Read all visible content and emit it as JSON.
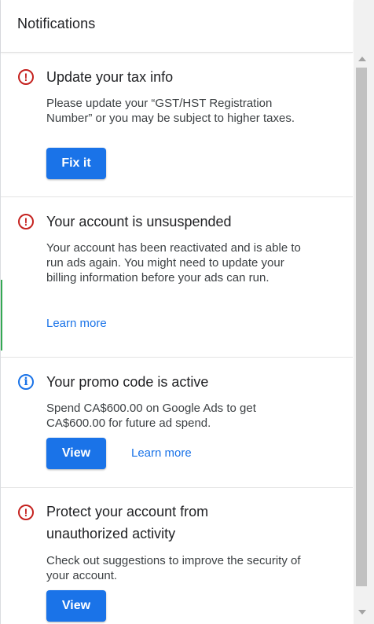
{
  "header": {
    "title": "Notifications"
  },
  "notifications": [
    {
      "title": "Update your tax info",
      "icon": "error-circle-icon",
      "body": "Please update your “GST/HST Registration Number” or you may be subject to higher taxes.",
      "primary_action": "Fix it"
    },
    {
      "title": "Your account is unsuspended",
      "icon": "error-circle-icon",
      "body": "Your account has been reactivated and is able to run ads again. You might need to update your billing information before your ads can run.",
      "link": "Learn more"
    },
    {
      "title": "Your promo code is active",
      "icon": "info-circle-icon",
      "body": "Spend CA$600.00 on Google Ads to get CA$600.00 for future ad spend.",
      "primary_action": "View",
      "link": "Learn more"
    },
    {
      "title": "Protect your account from unauthorized activity",
      "icon": "error-circle-icon",
      "body": "Check out suggestions to improve the security of your account.",
      "primary_action": "View"
    }
  ],
  "colors": {
    "accent": "#1a73e8",
    "error": "#c5221f"
  }
}
